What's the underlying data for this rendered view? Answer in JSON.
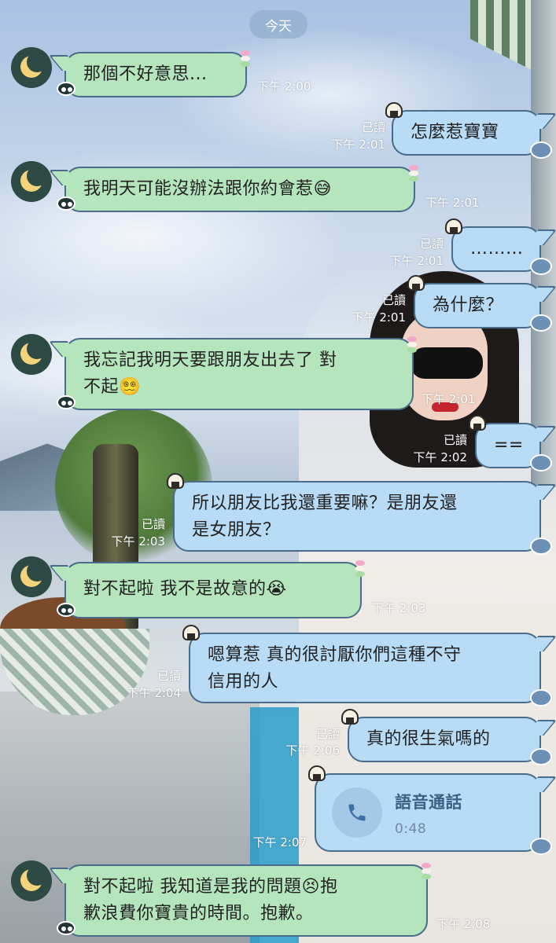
{
  "date_label": "今天",
  "messages": [
    {
      "side": "left",
      "text": "那個不好意思...",
      "time": "下午 2:00"
    },
    {
      "side": "right",
      "text": "怎麼惹寶寶",
      "read": "已讀",
      "time": "下午 2:01"
    },
    {
      "side": "left",
      "text": "我明天可能沒辦法跟你約會惹",
      "emoji": "😅",
      "time": "下午 2:01"
    },
    {
      "side": "right",
      "text": "………",
      "read": "已讀",
      "time": "下午 2:01"
    },
    {
      "side": "right",
      "text": "為什麼？",
      "read": "已讀",
      "time": "下午 2:01"
    },
    {
      "side": "left",
      "text_line1": "我忘記我明天要跟朋友出去了 對",
      "text_line2": "不起",
      "emoji": "😵‍💫",
      "time": "下午 2:01"
    },
    {
      "side": "right",
      "text": "==",
      "read": "已讀",
      "time": "下午 2:02"
    },
    {
      "side": "right",
      "text_line1": "所以朋友比我還重要嘛？是朋友還",
      "text_line2": "是女朋友？",
      "read": "已讀",
      "time": "下午 2:03"
    },
    {
      "side": "left",
      "text": "對不起啦 我不是故意的",
      "emoji": "😭",
      "time": "下午 2:03"
    },
    {
      "side": "right",
      "text_line1": "嗯算惹 真的很討厭你們這種不守",
      "text_line2": "信用的人",
      "read": "已讀",
      "time": "下午 2:04"
    },
    {
      "side": "right",
      "text": "真的很生氣嗎的",
      "read": "已讀",
      "time": "下午 2:06"
    },
    {
      "side": "right",
      "type": "call",
      "title": "語音通話",
      "duration": "0:48",
      "time": "下午 2:07"
    },
    {
      "side": "left",
      "text_line1": "對不起啦 我知道是我的問題",
      "emoji": "😣",
      "text_line1_tail": "抱",
      "text_line2": "歉浪費你寶貴的時間。抱歉。",
      "time": "下午 2:08"
    }
  ],
  "colors": {
    "bubble_left": "#b5e5bd",
    "bubble_right": "#b8dcf6",
    "bubble_border": "#4a6b8a",
    "meta_text": "#ffffff",
    "call_title": "#3c5f82"
  },
  "icons": {
    "avatar": "crescent-moon-avatar",
    "call": "phone-icon"
  }
}
